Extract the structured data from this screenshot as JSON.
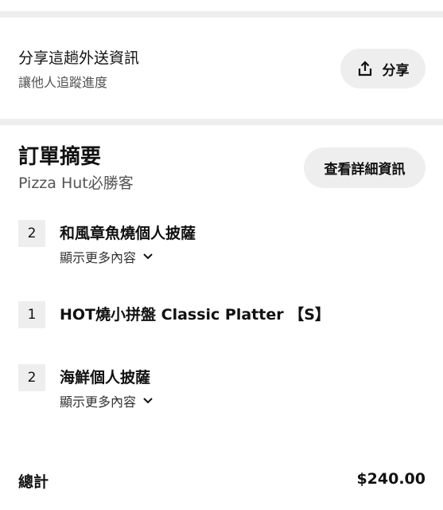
{
  "share": {
    "title": "分享這趟外送資訊",
    "subtitle": "讓他人追蹤進度",
    "button_label": "分享"
  },
  "summary": {
    "title": "訂單摘要",
    "restaurant": "Pizza Hut必勝客",
    "details_button": "查看詳細資訊"
  },
  "items": [
    {
      "qty": "2",
      "name": "和風章魚燒個人披薩",
      "more": "顯示更多內容"
    },
    {
      "qty": "1",
      "name": "HOT燒小拼盤 Classic Platter 【S】"
    },
    {
      "qty": "2",
      "name": "海鮮個人披薩",
      "more": "顯示更多內容"
    }
  ],
  "total": {
    "label": "總計",
    "value": "$240.00"
  }
}
